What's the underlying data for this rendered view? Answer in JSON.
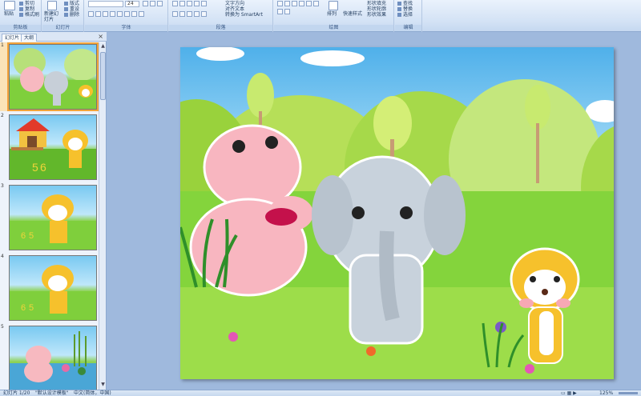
{
  "ribbon": {
    "clipboard": {
      "label": "剪贴板",
      "paste": "粘贴",
      "cut": "剪切",
      "copy": "复制",
      "format_painter": "格式刷"
    },
    "slides": {
      "label": "幻灯片",
      "new_slide": "新建幻灯片",
      "layout": "版式",
      "reset": "重设",
      "delete": "删除"
    },
    "font": {
      "label": "字体",
      "size": "24"
    },
    "paragraph": {
      "label": "段落",
      "text_direction": "文字方向",
      "align_text": "对齐文本",
      "smartart": "转换为 SmartArt"
    },
    "drawing": {
      "label": "绘图",
      "arrange": "排列",
      "quick_styles": "快速样式",
      "shape_fill": "形状填充",
      "shape_outline": "形状轮廓",
      "shape_effects": "形状效果"
    },
    "editing": {
      "label": "编辑",
      "find": "查找",
      "replace": "替换",
      "select": "选择"
    }
  },
  "panel": {
    "tab_slides": "幻灯片",
    "tab_outline": "大纲",
    "close": "×",
    "thumbnails": [
      {
        "num": "1",
        "selected": true
      },
      {
        "num": "2",
        "selected": false
      },
      {
        "num": "3",
        "selected": false
      },
      {
        "num": "4",
        "selected": false
      },
      {
        "num": "5",
        "selected": false
      }
    ]
  },
  "status": {
    "slide_counter": "幻灯片 1/20",
    "theme": "\"默认设计模板\"",
    "language": "中文(简体，中国)",
    "zoom": "125%"
  },
  "colors": {
    "ribbon_bg": "#d3e2f5",
    "workspace_bg": "#9fb9dd",
    "selected_thumb": "#f2a33a",
    "sky": "#79c9f1",
    "grass": "#7ed03b"
  }
}
